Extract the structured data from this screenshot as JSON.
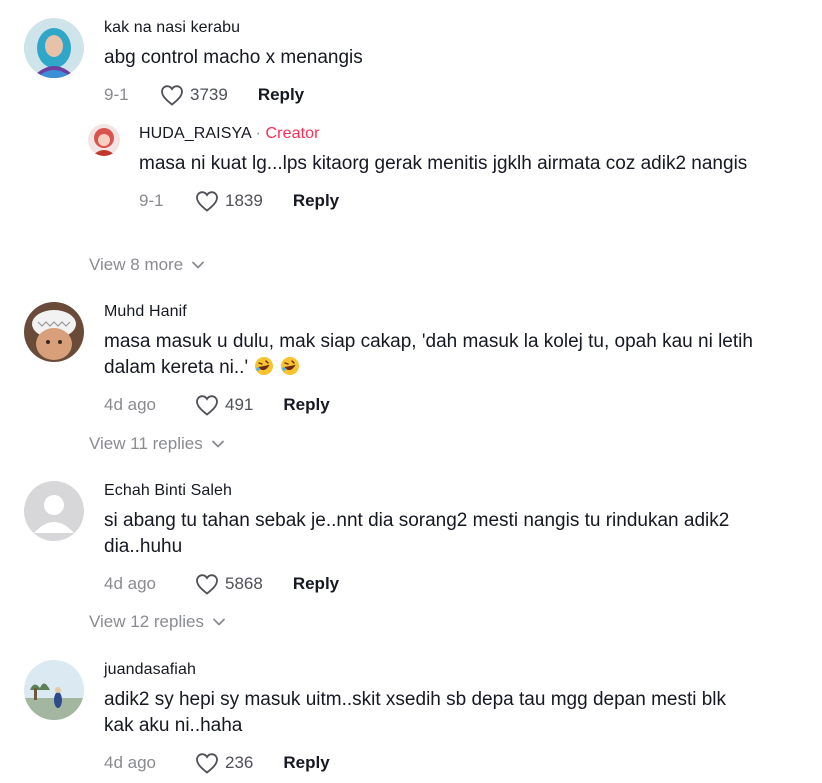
{
  "comments": [
    {
      "username": "kak na nasi kerabu",
      "text": "abg control macho x menangis",
      "date": "9-1",
      "likes": "3739",
      "reply_label": "Reply"
    },
    {
      "username": "HUDA_RAISYA",
      "creator_separator": "·",
      "creator_label": "Creator",
      "text": "masa ni kuat lg...lps kitaorg gerak menitis jgklh airmata coz adik2 nangis",
      "date": "9-1",
      "likes": "1839",
      "reply_label": "Reply"
    },
    {
      "username": "Muhd Hanif",
      "text": "masa masuk u dulu, mak siap cakap, 'dah masuk la kolej tu, opah kau ni letih dalam kereta ni..'",
      "emoji": "rolling-on-floor-laughing",
      "date": "4d ago",
      "likes": "491",
      "reply_label": "Reply"
    },
    {
      "username": "Echah Binti Saleh",
      "text": "si abang tu tahan sebak je..nnt dia sorang2 mesti nangis tu rindukan adik2 dia..huhu",
      "date": "4d ago",
      "likes": "5868",
      "reply_label": "Reply"
    },
    {
      "username": "juandasafiah",
      "text": "adik2 sy hepi sy masuk uitm..skit xsedih sb depa tau mgg depan mesti blk kak aku ni..haha",
      "date": "4d ago",
      "likes": "236",
      "reply_label": "Reply"
    }
  ],
  "view_more": [
    "View 8 more",
    "View 11 replies",
    "View 12 replies"
  ],
  "colors": {
    "creator": "#fe2c55",
    "muted": "#8a8b91",
    "text": "#161823"
  },
  "icons": [
    "heart-icon",
    "chevron-down-icon",
    "default-avatar-icon"
  ]
}
